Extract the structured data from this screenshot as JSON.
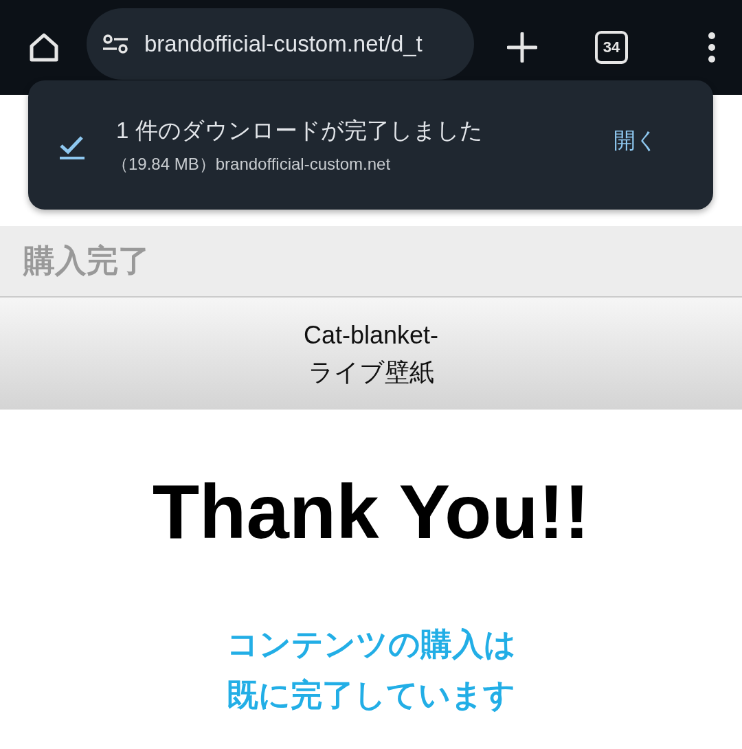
{
  "toolbar": {
    "url": "brandofficial-custom.net/d_t",
    "tab_count": "34"
  },
  "download_notice": {
    "title": "1 件のダウンロードが完了しました",
    "detail": "（19.84 MB）brandofficial-custom.net",
    "action": "開く"
  },
  "page": {
    "header": "購入完了",
    "product_name": [
      "Cat-blanket-",
      "ライブ壁紙"
    ],
    "heading": "Thank You!!",
    "message": [
      "コンテンツの購入は",
      "既に完了しています"
    ]
  }
}
